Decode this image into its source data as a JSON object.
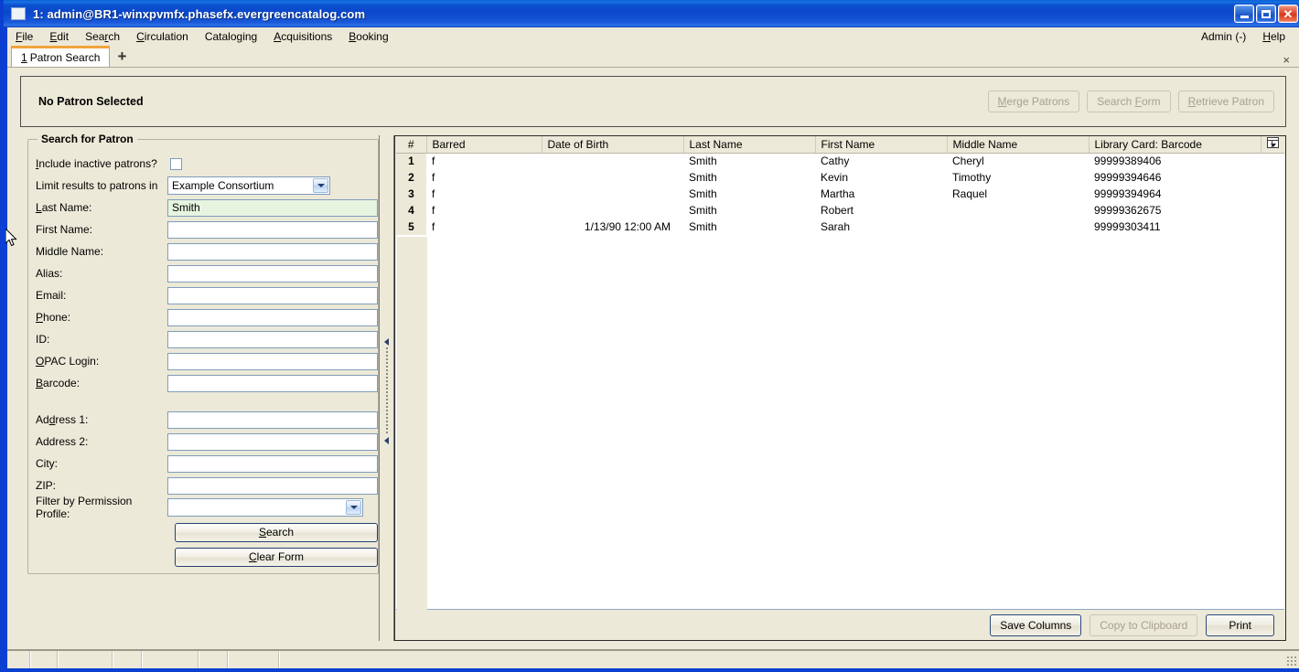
{
  "window": {
    "title": "1: admin@BR1-winxpvmfx.phasefx.evergreencatalog.com",
    "minimize_label": "Minimize",
    "maximize_label": "Maximize",
    "close_label": "✕"
  },
  "menubar": {
    "items": [
      {
        "label": "File",
        "accel": "F"
      },
      {
        "label": "Edit",
        "accel": "E"
      },
      {
        "label": "Search",
        "accel": "r"
      },
      {
        "label": "Circulation",
        "accel": "C"
      },
      {
        "label": "Cataloging",
        "accel": "g"
      },
      {
        "label": "Acquisitions",
        "accel": "A"
      },
      {
        "label": "Booking",
        "accel": "B"
      }
    ],
    "admin_label": "Admin (-)",
    "help_label": "Help"
  },
  "tabs": {
    "items": [
      {
        "number": "1",
        "label": "Patron Search"
      }
    ],
    "new_tab_label": "+",
    "close_label": "×"
  },
  "patron_header": {
    "title": "No Patron Selected",
    "buttons": [
      {
        "label": "Merge Patrons",
        "enabled": false
      },
      {
        "label": "Search Form",
        "enabled": false
      },
      {
        "label": "Retrieve Patron",
        "enabled": false
      }
    ]
  },
  "search_form": {
    "legend": "Search for Patron",
    "fields": {
      "include_inactive_label": "Include inactive patrons?",
      "include_inactive_checked": false,
      "limit_results_label": "Limit results to patrons in",
      "limit_results_value": "Example Consortium",
      "last_name_label": "Last Name:",
      "last_name_value": "Smith",
      "first_name_label": "First Name:",
      "first_name_value": "",
      "middle_name_label": "Middle Name:",
      "middle_name_value": "",
      "alias_label": "Alias:",
      "alias_value": "",
      "email_label": "Email:",
      "email_value": "",
      "phone_label": "Phone:",
      "phone_value": "",
      "id_label": "ID:",
      "id_value": "",
      "opac_login_label": "OPAC Login:",
      "opac_login_value": "",
      "barcode_label": "Barcode:",
      "barcode_value": "",
      "address1_label": "Address 1:",
      "address1_value": "",
      "address2_label": "Address 2:",
      "address2_value": "",
      "city_label": "City:",
      "city_value": "",
      "zip_label": "ZIP:",
      "zip_value": "",
      "permission_profile_label": "Filter by Permission Profile:",
      "permission_profile_value": ""
    },
    "search_button": "Search",
    "clear_button": "Clear Form"
  },
  "results": {
    "columns": [
      "#",
      "Barred",
      "Date of Birth",
      "Last Name",
      "First Name",
      "Middle Name",
      "Library Card: Barcode"
    ],
    "rows": [
      {
        "num": "1",
        "barred": "f",
        "dob": "",
        "last": "Smith",
        "first": "Cathy",
        "middle": "Cheryl",
        "card": "99999389406"
      },
      {
        "num": "2",
        "barred": "f",
        "dob": "",
        "last": "Smith",
        "first": "Kevin",
        "middle": "Timothy",
        "card": "99999394646"
      },
      {
        "num": "3",
        "barred": "f",
        "dob": "",
        "last": "Smith",
        "first": "Martha",
        "middle": "Raquel",
        "card": "99999394964"
      },
      {
        "num": "4",
        "barred": "f",
        "dob": "",
        "last": "Smith",
        "first": "Robert",
        "middle": "",
        "card": "99999362675"
      },
      {
        "num": "5",
        "barred": "f",
        "dob": "1/13/90 12:00 AM",
        "last": "Smith",
        "first": "Sarah",
        "middle": "",
        "card": "99999303411"
      }
    ],
    "column_picker_label": "Column picker",
    "footer_buttons": [
      {
        "label": "Save Columns",
        "enabled": true
      },
      {
        "label": "Copy to Clipboard",
        "enabled": false
      },
      {
        "label": "Print",
        "enabled": true
      }
    ]
  },
  "statusbar": {
    "segments": [
      "",
      "",
      "",
      "",
      "",
      "",
      "",
      ""
    ]
  },
  "colors": {
    "titlebar_blue": "#0b47cb",
    "chrome_beige": "#ece9d8",
    "tab_accent_orange": "#f2a33c",
    "focused_input_green": "#e7f5e0",
    "input_border_blue": "#7f9db9"
  }
}
